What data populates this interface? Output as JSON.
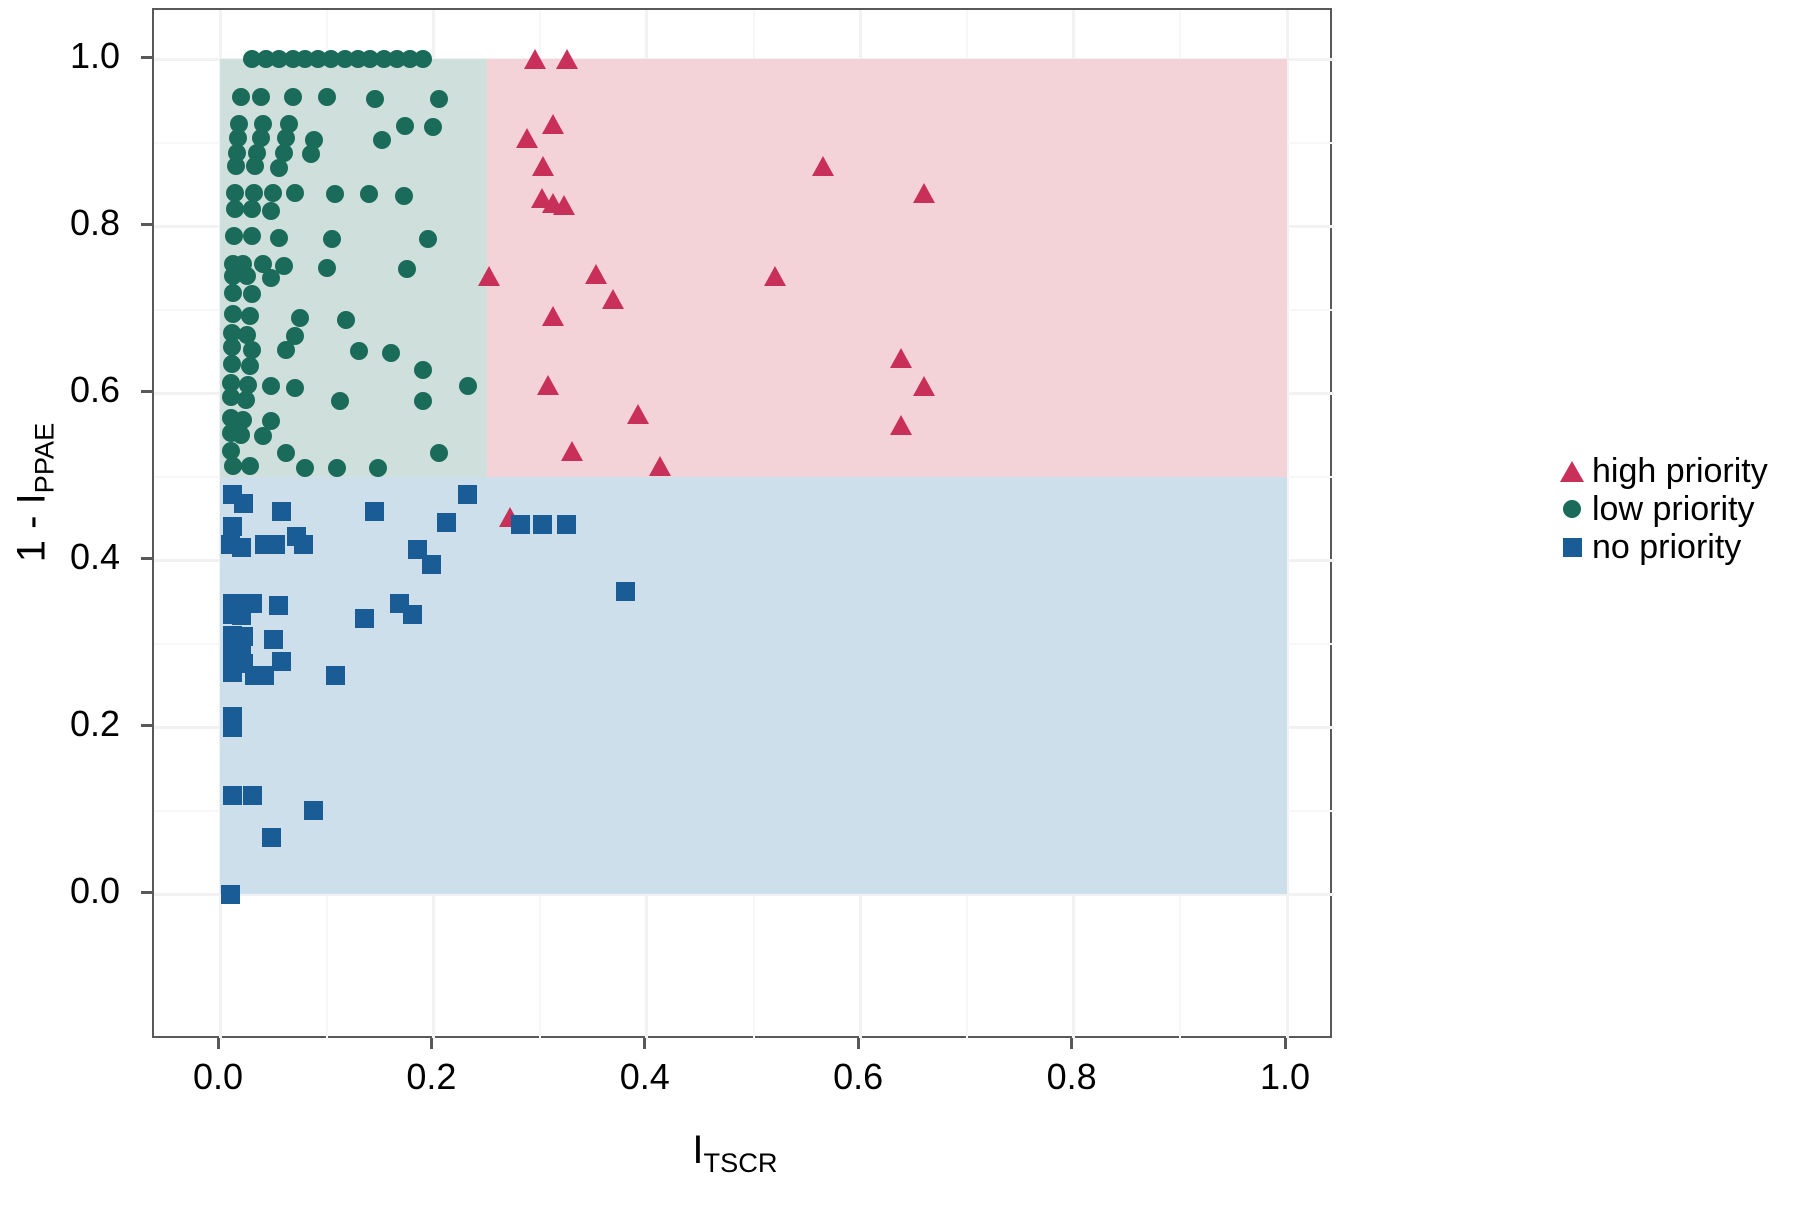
{
  "chart_data": {
    "type": "scatter",
    "title": "",
    "xlabel": "I_TSCR",
    "xlabel_base": "I",
    "xlabel_sub": "TSCR",
    "ylabel": "1 - I_PPAE",
    "ylabel_base": "1 - I",
    "ylabel_sub": "PPAE",
    "xlim": [
      -0.06,
      1.045
    ],
    "ylim": [
      -0.05,
      1.03
    ],
    "xticks": [
      0.0,
      0.2,
      0.4,
      0.6,
      0.8,
      1.0
    ],
    "xtick_labels": [
      "0.0",
      "0.2",
      "0.4",
      "0.6",
      "0.8",
      "1.0"
    ],
    "yticks": [
      0.0,
      0.2,
      0.4,
      0.6,
      0.8,
      1.0
    ],
    "ytick_labels": [
      "0.0",
      "0.2",
      "0.4",
      "0.6",
      "0.8",
      "1.0"
    ],
    "grid": true,
    "legend_position": "right",
    "regions": [
      {
        "name": "low-priority-region",
        "x0": 0.0,
        "x1": 0.25,
        "y0": 0.5,
        "y1": 1.0,
        "color": "#cfe0dc"
      },
      {
        "name": "high-priority-region",
        "x0": 0.25,
        "x1": 1.0,
        "y0": 0.5,
        "y1": 1.0,
        "color": "#f4d3d8"
      },
      {
        "name": "no-priority-region",
        "x0": 0.0,
        "x1": 1.0,
        "y0": 0.0,
        "y1": 0.5,
        "color": "#cddfeb"
      }
    ],
    "series": [
      {
        "name": "high priority",
        "marker": "triangle",
        "color": "#c8305a",
        "points": [
          [
            0.295,
            1.0
          ],
          [
            0.325,
            1.0
          ],
          [
            0.288,
            0.905
          ],
          [
            0.312,
            0.922
          ],
          [
            0.303,
            0.872
          ],
          [
            0.302,
            0.833
          ],
          [
            0.312,
            0.828
          ],
          [
            0.322,
            0.825
          ],
          [
            0.565,
            0.872
          ],
          [
            0.66,
            0.84
          ],
          [
            0.252,
            0.74
          ],
          [
            0.352,
            0.742
          ],
          [
            0.52,
            0.74
          ],
          [
            0.368,
            0.712
          ],
          [
            0.312,
            0.692
          ],
          [
            0.638,
            0.642
          ],
          [
            0.307,
            0.61
          ],
          [
            0.66,
            0.608
          ],
          [
            0.392,
            0.575
          ],
          [
            0.638,
            0.562
          ],
          [
            0.33,
            0.53
          ],
          [
            0.412,
            0.512
          ],
          [
            0.272,
            0.452
          ]
        ]
      },
      {
        "name": "low priority",
        "marker": "circle",
        "color": "#1a6b5a",
        "points": [
          [
            0.03,
            1.0
          ],
          [
            0.043,
            1.0
          ],
          [
            0.055,
            1.0
          ],
          [
            0.068,
            1.0
          ],
          [
            0.08,
            1.0
          ],
          [
            0.092,
            1.0
          ],
          [
            0.104,
            1.0
          ],
          [
            0.117,
            1.0
          ],
          [
            0.129,
            1.0
          ],
          [
            0.141,
            1.0
          ],
          [
            0.154,
            1.0
          ],
          [
            0.166,
            1.0
          ],
          [
            0.178,
            1.0
          ],
          [
            0.19,
            1.0
          ],
          [
            0.02,
            0.955
          ],
          [
            0.038,
            0.955
          ],
          [
            0.068,
            0.955
          ],
          [
            0.1,
            0.955
          ],
          [
            0.145,
            0.952
          ],
          [
            0.205,
            0.952
          ],
          [
            0.018,
            0.922
          ],
          [
            0.04,
            0.922
          ],
          [
            0.065,
            0.922
          ],
          [
            0.173,
            0.92
          ],
          [
            0.2,
            0.918
          ],
          [
            0.017,
            0.905
          ],
          [
            0.038,
            0.905
          ],
          [
            0.062,
            0.905
          ],
          [
            0.088,
            0.903
          ],
          [
            0.152,
            0.903
          ],
          [
            0.016,
            0.888
          ],
          [
            0.035,
            0.888
          ],
          [
            0.06,
            0.888
          ],
          [
            0.085,
            0.886
          ],
          [
            0.015,
            0.872
          ],
          [
            0.033,
            0.872
          ],
          [
            0.055,
            0.87
          ],
          [
            0.014,
            0.84
          ],
          [
            0.032,
            0.84
          ],
          [
            0.05,
            0.84
          ],
          [
            0.07,
            0.84
          ],
          [
            0.108,
            0.838
          ],
          [
            0.14,
            0.838
          ],
          [
            0.172,
            0.836
          ],
          [
            0.014,
            0.82
          ],
          [
            0.03,
            0.82
          ],
          [
            0.048,
            0.818
          ],
          [
            0.013,
            0.788
          ],
          [
            0.03,
            0.788
          ],
          [
            0.055,
            0.786
          ],
          [
            0.105,
            0.785
          ],
          [
            0.195,
            0.785
          ],
          [
            0.012,
            0.755
          ],
          [
            0.022,
            0.755
          ],
          [
            0.04,
            0.755
          ],
          [
            0.06,
            0.752
          ],
          [
            0.1,
            0.75
          ],
          [
            0.175,
            0.748
          ],
          [
            0.012,
            0.74
          ],
          [
            0.025,
            0.74
          ],
          [
            0.048,
            0.738
          ],
          [
            0.012,
            0.72
          ],
          [
            0.03,
            0.718
          ],
          [
            0.012,
            0.695
          ],
          [
            0.028,
            0.692
          ],
          [
            0.075,
            0.69
          ],
          [
            0.118,
            0.688
          ],
          [
            0.011,
            0.672
          ],
          [
            0.025,
            0.67
          ],
          [
            0.07,
            0.668
          ],
          [
            0.011,
            0.655
          ],
          [
            0.03,
            0.652
          ],
          [
            0.062,
            0.652
          ],
          [
            0.13,
            0.65
          ],
          [
            0.16,
            0.648
          ],
          [
            0.011,
            0.635
          ],
          [
            0.028,
            0.632
          ],
          [
            0.19,
            0.628
          ],
          [
            0.01,
            0.612
          ],
          [
            0.026,
            0.61
          ],
          [
            0.048,
            0.608
          ],
          [
            0.07,
            0.606
          ],
          [
            0.232,
            0.608
          ],
          [
            0.01,
            0.595
          ],
          [
            0.024,
            0.592
          ],
          [
            0.112,
            0.59
          ],
          [
            0.19,
            0.59
          ],
          [
            0.01,
            0.57
          ],
          [
            0.022,
            0.568
          ],
          [
            0.048,
            0.566
          ],
          [
            0.01,
            0.552
          ],
          [
            0.02,
            0.55
          ],
          [
            0.04,
            0.548
          ],
          [
            0.01,
            0.53
          ],
          [
            0.062,
            0.528
          ],
          [
            0.205,
            0.528
          ],
          [
            0.012,
            0.512
          ],
          [
            0.028,
            0.512
          ],
          [
            0.08,
            0.51
          ],
          [
            0.11,
            0.51
          ],
          [
            0.148,
            0.51
          ]
        ]
      },
      {
        "name": "no priority",
        "marker": "square",
        "color": "#1a5c96",
        "points": [
          [
            0.012,
            0.478
          ],
          [
            0.232,
            0.478
          ],
          [
            0.022,
            0.468
          ],
          [
            0.058,
            0.458
          ],
          [
            0.145,
            0.458
          ],
          [
            0.212,
            0.445
          ],
          [
            0.282,
            0.443
          ],
          [
            0.302,
            0.443
          ],
          [
            0.325,
            0.443
          ],
          [
            0.012,
            0.44
          ],
          [
            0.01,
            0.418
          ],
          [
            0.02,
            0.415
          ],
          [
            0.042,
            0.418
          ],
          [
            0.052,
            0.418
          ],
          [
            0.078,
            0.418
          ],
          [
            0.185,
            0.412
          ],
          [
            0.072,
            0.428
          ],
          [
            0.198,
            0.395
          ],
          [
            0.38,
            0.362
          ],
          [
            0.012,
            0.348
          ],
          [
            0.022,
            0.348
          ],
          [
            0.03,
            0.348
          ],
          [
            0.055,
            0.345
          ],
          [
            0.168,
            0.348
          ],
          [
            0.012,
            0.335
          ],
          [
            0.02,
            0.333
          ],
          [
            0.18,
            0.335
          ],
          [
            0.135,
            0.33
          ],
          [
            0.012,
            0.31
          ],
          [
            0.022,
            0.308
          ],
          [
            0.05,
            0.305
          ],
          [
            0.012,
            0.295
          ],
          [
            0.02,
            0.293
          ],
          [
            0.012,
            0.278
          ],
          [
            0.022,
            0.276
          ],
          [
            0.058,
            0.278
          ],
          [
            0.012,
            0.265
          ],
          [
            0.032,
            0.262
          ],
          [
            0.042,
            0.262
          ],
          [
            0.108,
            0.262
          ],
          [
            0.012,
            0.212
          ],
          [
            0.012,
            0.2
          ],
          [
            0.012,
            0.118
          ],
          [
            0.03,
            0.118
          ],
          [
            0.088,
            0.1
          ],
          [
            0.048,
            0.068
          ],
          [
            0.01,
            0.0
          ]
        ]
      }
    ]
  },
  "legend": {
    "entries": [
      {
        "label": "high priority",
        "marker": "triangle",
        "color": "#c8305a"
      },
      {
        "label": "low priority",
        "marker": "circle",
        "color": "#1a6b5a"
      },
      {
        "label": "no priority",
        "marker": "square",
        "color": "#1a5c96"
      }
    ]
  }
}
